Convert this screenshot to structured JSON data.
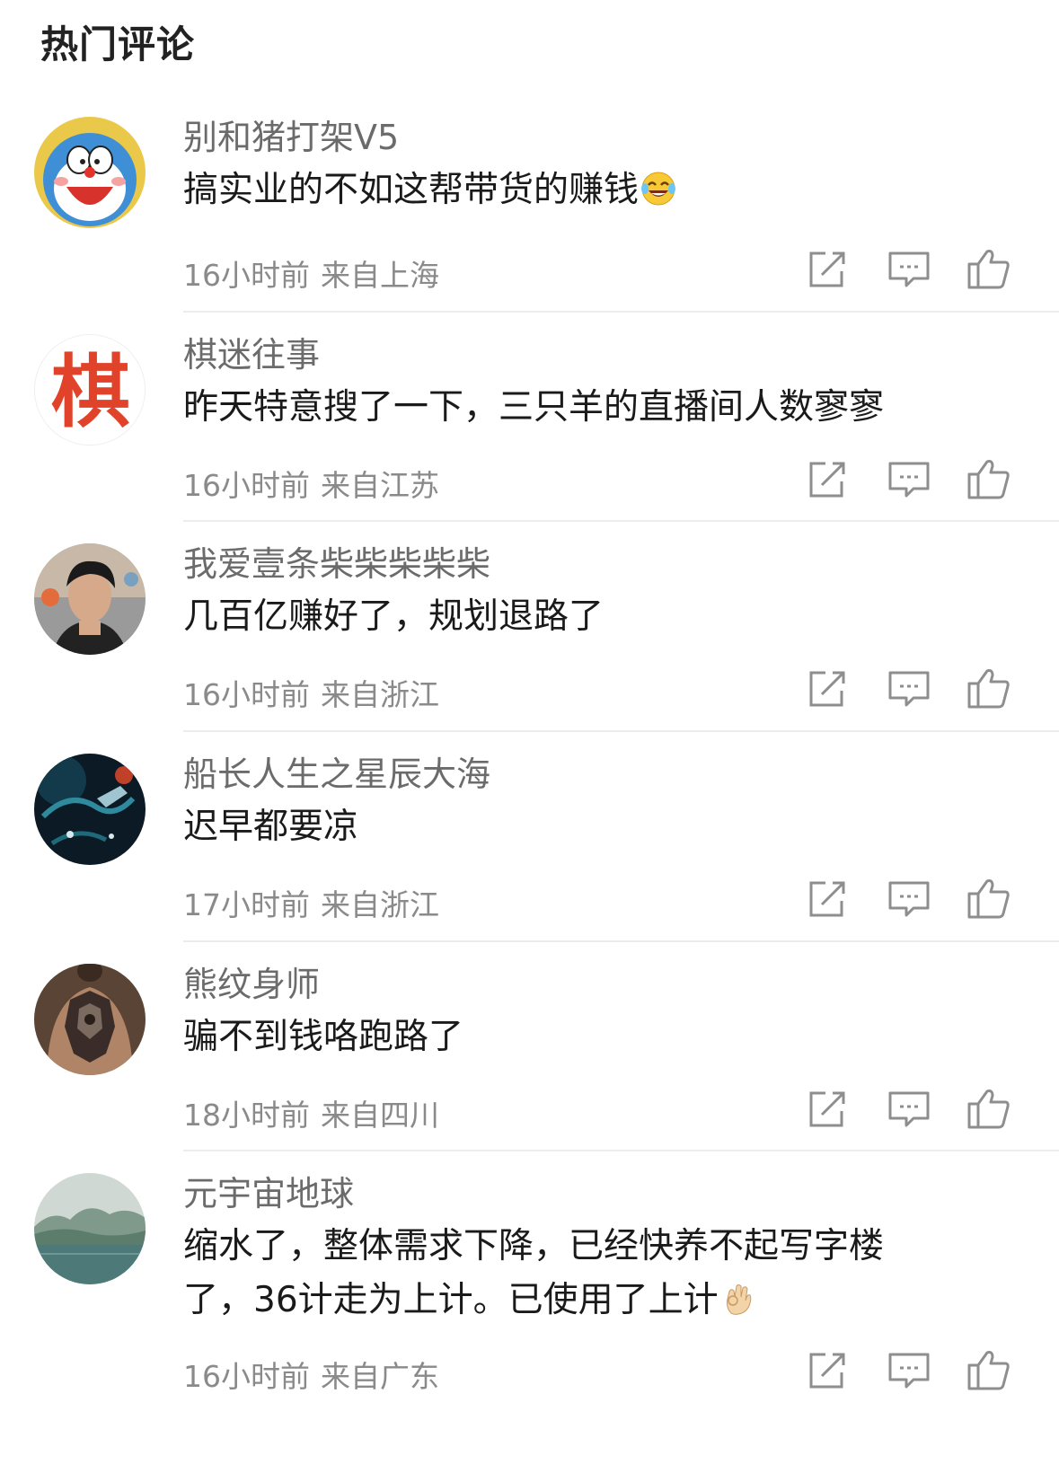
{
  "section_title": "热门评论",
  "comments": [
    {
      "username": "别和猪打架V5",
      "content": "搞实业的不如这帮带货的赚钱",
      "emoji": "laughing-tears-emoji",
      "time": "16小时前",
      "location": "来自上海"
    },
    {
      "username": "棋迷往事",
      "content": "昨天特意搜了一下，三只羊的直播间人数寥寥",
      "avatar_text": "棋",
      "time": "16小时前",
      "location": "来自江苏"
    },
    {
      "username": "我爱壹条柴柴柴柴柴",
      "content": "几百亿赚好了，规划退路了",
      "time": "16小时前",
      "location": "来自浙江"
    },
    {
      "username": "船长人生之星辰大海",
      "content": "迟早都要凉",
      "time": "17小时前",
      "location": "来自浙江"
    },
    {
      "username": "熊纹身师",
      "content": "骗不到钱咯跑路了",
      "time": "18小时前",
      "location": "来自四川"
    },
    {
      "username": "元宇宙地球",
      "content": "缩水了，整体需求下降，已经快养不起写字楼了，36计走为上计。已使用了上计",
      "emoji": "ok-hand-emoji",
      "time": "16小时前",
      "location": "来自广东"
    }
  ],
  "icons": {
    "share": "share-icon",
    "reply": "comment-icon",
    "like": "thumbs-up-icon"
  },
  "colors": {
    "username": "#6b6b6b",
    "content": "#1a1a1a",
    "meta": "#8a8a8a",
    "icon": "#8e8e8e",
    "divider": "#ececec"
  }
}
